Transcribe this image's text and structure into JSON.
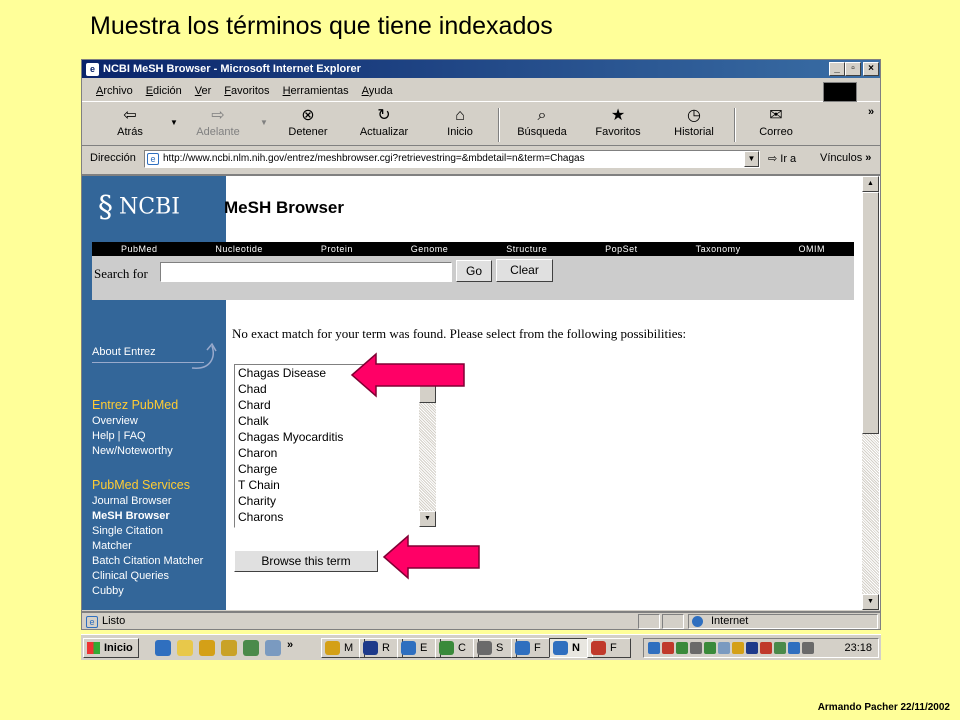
{
  "slide": {
    "title": "Muestra los términos que tiene indexados",
    "credit": "Armando Pacher 22/11/2002"
  },
  "window": {
    "title": "NCBI MeSH Browser - Microsoft Internet Explorer",
    "controls": [
      "_",
      "▫",
      "×"
    ]
  },
  "menu": [
    "Archivo",
    "Edición",
    "Ver",
    "Favoritos",
    "Herramientas",
    "Ayuda"
  ],
  "toolbar": {
    "buttons": [
      {
        "label": "Atrás",
        "icon": "back-arrow-icon",
        "glyph": "⇦"
      },
      {
        "label": "Adelante",
        "icon": "forward-arrow-icon",
        "glyph": "⇨"
      },
      {
        "label": "Detener",
        "icon": "stop-icon",
        "glyph": "⊗"
      },
      {
        "label": "Actualizar",
        "icon": "refresh-icon",
        "glyph": "↻"
      },
      {
        "label": "Inicio",
        "icon": "home-icon",
        "glyph": "⌂"
      },
      {
        "label": "Búsqueda",
        "icon": "search-icon",
        "glyph": "⌕"
      },
      {
        "label": "Favoritos",
        "icon": "favorites-icon",
        "glyph": "★"
      },
      {
        "label": "Historial",
        "icon": "history-icon",
        "glyph": "◷"
      },
      {
        "label": "Correo",
        "icon": "mail-icon",
        "glyph": "✉"
      }
    ],
    "more": "»"
  },
  "address": {
    "label": "Dirección",
    "url": "http://www.ncbi.nlm.nih.gov/entrez/meshbrowser.cgi?retrievestring=&mbdetail=n&term=Chagas",
    "go_label": "Ir a",
    "links_label": "Vínculos",
    "links_more": "»"
  },
  "page": {
    "logo_text": "NCBI",
    "heading": "MeSH Browser",
    "nav": [
      "PubMed",
      "Nucleotide",
      "Protein",
      "Genome",
      "Structure",
      "PopSet",
      "Taxonomy",
      "OMIM"
    ],
    "search_label": "Search for",
    "go_button": "Go",
    "clear_button": "Clear",
    "message": "No exact match for your term was found. Please select from the following possibilities:",
    "options": [
      "Chagas Disease",
      "Chad",
      "Chard",
      "Chalk",
      "Chagas Myocarditis",
      "Charon",
      "Charge",
      "T Chain",
      "Charity",
      "Charons"
    ],
    "browse_button": "Browse this term"
  },
  "sidebar": {
    "about": "About Entrez",
    "section1": {
      "title": "Entrez PubMed",
      "items": [
        "Overview",
        "Help | FAQ",
        "New/Noteworthy"
      ]
    },
    "section2": {
      "title": "PubMed Services",
      "items": [
        "Journal Browser",
        "MeSH Browser",
        "Single Citation",
        "Matcher",
        "Batch Citation Matcher",
        "Clinical Queries",
        "Cubby"
      ]
    }
  },
  "status": {
    "left": "Listo",
    "zone": "Internet"
  },
  "taskbar": {
    "start": "Inicio",
    "quick_more": "»",
    "tasks": [
      {
        "label": "M",
        "color": "#d4a017"
      },
      {
        "label": "R",
        "color": "#1e3a8a"
      },
      {
        "label": "E",
        "color": "#2f6fbf"
      },
      {
        "label": "C",
        "color": "#3a8a3a"
      },
      {
        "label": "S",
        "color": "#6a6a6a"
      },
      {
        "label": "F",
        "color": "#2f6fbf"
      },
      {
        "label": "N",
        "color": "#2f6fbf"
      },
      {
        "label": "F",
        "color": "#c0392b"
      }
    ],
    "clock": "23:18"
  },
  "colors": {
    "slide_bg": "#ffff99",
    "ncbi_blue": "#336699",
    "sidebar_heading": "#ffcc33",
    "pointer_arrow": "#ff0066"
  }
}
